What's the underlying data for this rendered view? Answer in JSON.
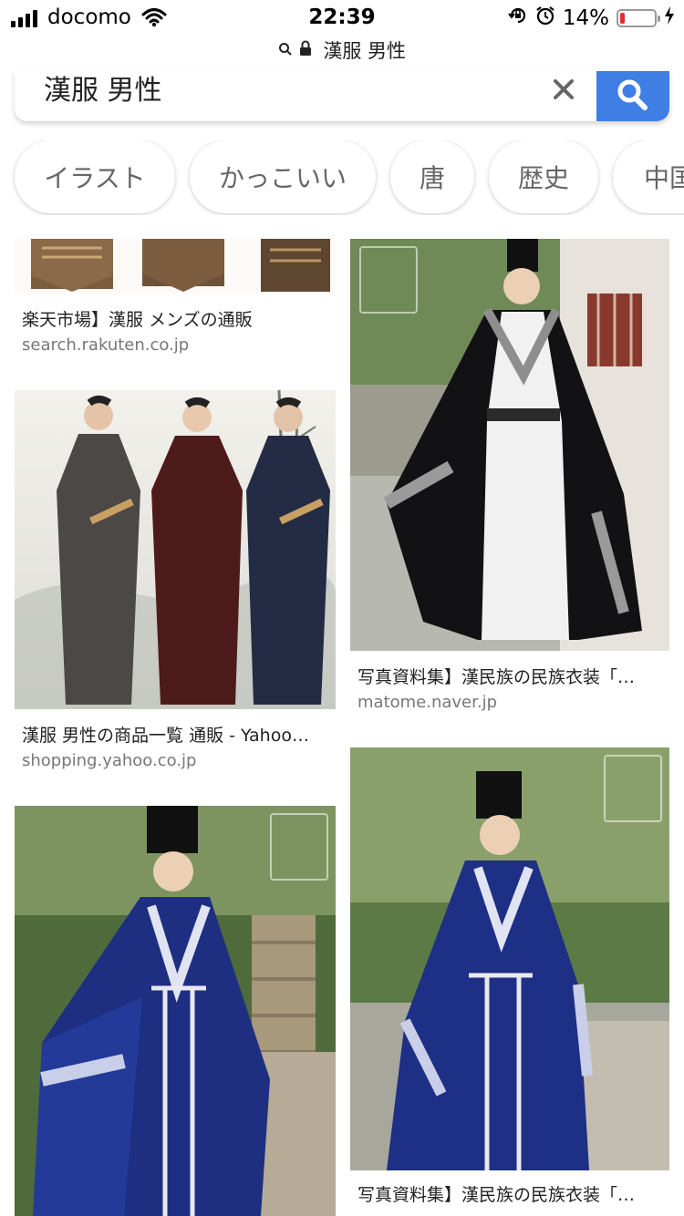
{
  "status": {
    "carrier": "docomo",
    "time": "22:39",
    "battery": "14%",
    "battery_level": 0.14
  },
  "url": {
    "text": "漢服 男性"
  },
  "search": {
    "query": "漢服 男性"
  },
  "chips": [
    "イラスト",
    "かっこいい",
    "唐",
    "歴史",
    "中国"
  ],
  "results": [
    {
      "caption": "楽天市場】漢服 メンズの通販",
      "domain": "search.rakuten.co.jp"
    },
    {
      "caption": "漢服 男性の商品一覧 通販 - Yahoo…",
      "domain": "shopping.yahoo.co.jp"
    },
    {
      "caption": "写真資料集】漢民族の民族衣装「…",
      "domain": "matome.naver.jp"
    },
    {
      "caption": "写真資料集】漢民族の民族衣装「…",
      "domain": ""
    }
  ],
  "colors": {
    "accent": "#3f7fe6",
    "battery_low": "#e02d2d"
  }
}
